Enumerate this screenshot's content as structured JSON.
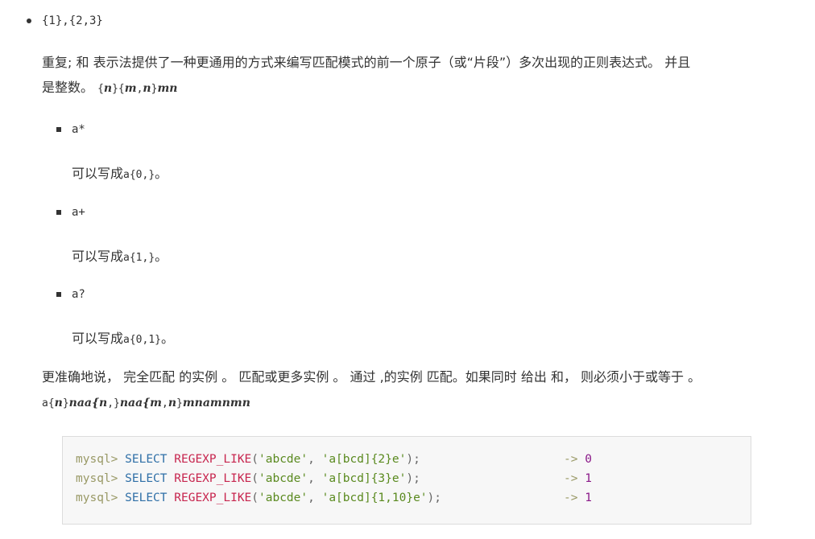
{
  "top_item": "{1},{2,3}",
  "para1": {
    "line1": "重复; 和 表示法提供了一种更通用的方式来编写匹配模式的前一个原子（或“片段”）多次出现的正则表达式。 并且",
    "line2_prefix": "是整数。 ",
    "code_a": "{",
    "code_n": "n",
    "code_b": "}{",
    "code_m": "m",
    "code_c": ",",
    "code_n2": "n",
    "code_d": "}",
    "code_tail": "mn"
  },
  "items": [
    {
      "label": "a*",
      "desc_prefix": "可以写成",
      "desc_code": "a{0,}",
      "desc_suffix": "。"
    },
    {
      "label": "a+",
      "desc_prefix": "可以写成",
      "desc_code": "a{1,}",
      "desc_suffix": "。"
    },
    {
      "label": "a?",
      "desc_prefix": "可以写成",
      "desc_code": "a{0,1}",
      "desc_suffix": "。"
    }
  ],
  "para2": {
    "line1": "更准确地说， 完全匹配 的实例 。 匹配或更多实例 。 通过 ,的实例 匹配。如果同时 给出 和， 则必须小于或等于 。",
    "l2_a": "a{",
    "l2_b": "n",
    "l2_c": "}",
    "l2_d": "naa{",
    "l2_e": "n",
    "l2_f": ",}",
    "l2_g": "naa{",
    "l2_h": "m",
    "l2_i": ",",
    "l2_j": "n",
    "l2_k": "}",
    "l2_l": "mnamnmn"
  },
  "code_lines": [
    {
      "prompt": "mysql>",
      "kw": "SELECT",
      "fn": "REGEXP_LIKE",
      "open": "(",
      "arg1": "'abcde'",
      "comma": ", ",
      "arg2": "'a[bcd]{2}e'",
      "close": ");",
      "arrow": "->",
      "result": "0"
    },
    {
      "prompt": "mysql>",
      "kw": "SELECT",
      "fn": "REGEXP_LIKE",
      "open": "(",
      "arg1": "'abcde'",
      "comma": ", ",
      "arg2": "'a[bcd]{3}e'",
      "close": ");",
      "arrow": "->",
      "result": "1"
    },
    {
      "prompt": "mysql>",
      "kw": "SELECT",
      "fn": "REGEXP_LIKE",
      "open": "(",
      "arg1": "'abcde'",
      "comma": ", ",
      "arg2": "'a[bcd]{1,10}e'",
      "close": ");",
      "arrow": "->",
      "result": "1"
    }
  ]
}
